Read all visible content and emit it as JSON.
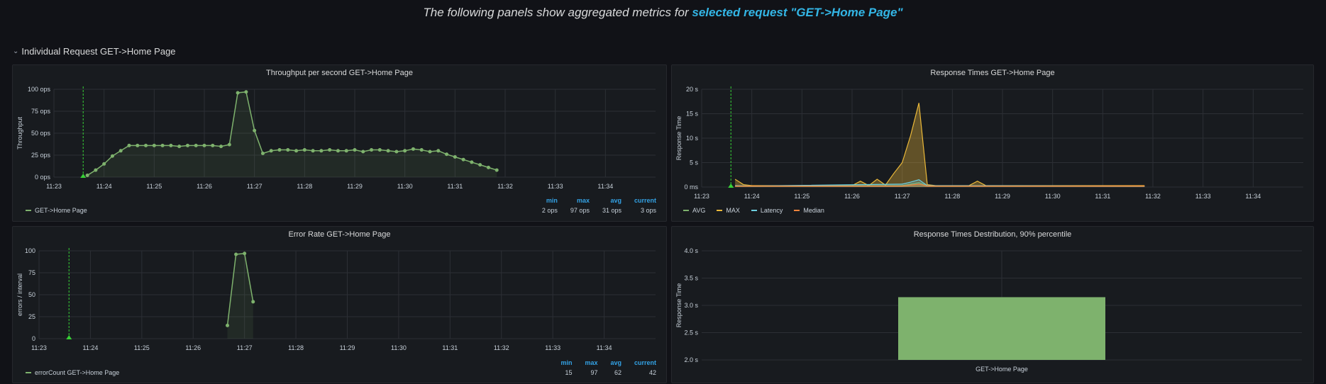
{
  "banner": {
    "prefix": "The following panels show aggregated metrics for",
    "highlight": "selected request \"GET->Home Page\""
  },
  "row": {
    "title": "Individual Request GET->Home Page",
    "icon": "chevron-down-icon"
  },
  "colors": {
    "green": "#7eb26d",
    "yellow": "#eab839",
    "cyan": "#6ed0e0",
    "orange": "#ef843c",
    "bar": "#7eb26d",
    "stat_header": "#33a2e5",
    "link": "#33b5e5"
  },
  "panels": {
    "throughput": {
      "title": "Throughput per second GET->Home Page",
      "ylabel": "Throughput",
      "legend": [
        {
          "name": "GET->Home Page",
          "color": "#7eb26d"
        }
      ],
      "stats": {
        "headers": [
          "min",
          "max",
          "avg",
          "current"
        ],
        "values": [
          "2 ops",
          "97 ops",
          "31 ops",
          "3 ops"
        ]
      }
    },
    "response_times": {
      "title": "Response Times GET->Home Page",
      "ylabel": "Response Time",
      "legend": [
        {
          "name": "AVG",
          "color": "#7eb26d"
        },
        {
          "name": "MAX",
          "color": "#eab839"
        },
        {
          "name": "Latency",
          "color": "#6ed0e0"
        },
        {
          "name": "Median",
          "color": "#ef843c"
        }
      ]
    },
    "error_rate": {
      "title": "Error Rate GET->Home Page",
      "ylabel": "errors / interval",
      "legend": [
        {
          "name": "errorCount GET->Home Page",
          "color": "#7eb26d"
        }
      ],
      "stats": {
        "headers": [
          "min",
          "max",
          "avg",
          "current"
        ],
        "values": [
          "15",
          "97",
          "62",
          "42"
        ]
      }
    },
    "distribution": {
      "title": "Response Times Destribution, 90% percentile",
      "ylabel": "Response Time",
      "category": "GET->Home Page"
    }
  },
  "chart_data": [
    {
      "type": "line",
      "title": "Throughput per second GET->Home Page",
      "ylabel": "Throughput",
      "ylim": [
        0,
        100
      ],
      "yticks": [
        "0 ops",
        "25 ops",
        "50 ops",
        "75 ops",
        "100 ops"
      ],
      "xticks": [
        "11:23",
        "11:24",
        "11:25",
        "11:26",
        "11:27",
        "11:28",
        "11:29",
        "11:30",
        "11:31",
        "11:32",
        "11:33",
        "11:34"
      ],
      "xlim": [
        "11:23",
        "11:35"
      ],
      "marker": "11:23:35",
      "series": [
        {
          "name": "GET->Home Page",
          "x": [
            "11:23:40",
            "11:23:50",
            "11:24:00",
            "11:24:10",
            "11:24:20",
            "11:24:30",
            "11:24:40",
            "11:24:50",
            "11:25:00",
            "11:25:10",
            "11:25:20",
            "11:25:30",
            "11:25:40",
            "11:25:50",
            "11:26:00",
            "11:26:10",
            "11:26:20",
            "11:26:30",
            "11:26:40",
            "11:26:50",
            "11:27:00",
            "11:27:10",
            "11:27:20",
            "11:27:30",
            "11:27:40",
            "11:27:50",
            "11:28:00",
            "11:28:10",
            "11:28:20",
            "11:28:30",
            "11:28:40",
            "11:28:50",
            "11:29:00",
            "11:29:10",
            "11:29:20",
            "11:29:30",
            "11:29:40",
            "11:29:50",
            "11:30:00",
            "11:30:10",
            "11:30:20",
            "11:30:30",
            "11:30:40",
            "11:30:50",
            "11:31:00",
            "11:31:10",
            "11:31:20",
            "11:31:30",
            "11:31:40",
            "11:31:50"
          ],
          "values": [
            2,
            8,
            15,
            24,
            30,
            36,
            36,
            36,
            36,
            36,
            36,
            35,
            36,
            36,
            36,
            36,
            35,
            37,
            96,
            97,
            53,
            27,
            30,
            31,
            31,
            30,
            31,
            30,
            30,
            31,
            30,
            30,
            31,
            29,
            31,
            31,
            30,
            29,
            30,
            32,
            31,
            29,
            30,
            26,
            23,
            20,
            17,
            14,
            11,
            8
          ]
        }
      ]
    },
    {
      "type": "area",
      "title": "Response Times GET->Home Page",
      "ylabel": "Response Time",
      "ylim": [
        0,
        20
      ],
      "yticks": [
        "0 ms",
        "5 s",
        "10 s",
        "15 s",
        "20 s"
      ],
      "xticks": [
        "11:23",
        "11:24",
        "11:25",
        "11:26",
        "11:27",
        "11:28",
        "11:29",
        "11:30",
        "11:31",
        "11:32",
        "11:33",
        "11:34"
      ],
      "xlim": [
        "11:23",
        "11:35"
      ],
      "marker": "11:23:35",
      "series": [
        {
          "name": "MAX",
          "x": [
            "11:23:40",
            "11:23:50",
            "11:24:00",
            "11:25:00",
            "11:26:00",
            "11:26:10",
            "11:26:20",
            "11:26:30",
            "11:26:40",
            "11:26:50",
            "11:27:00",
            "11:27:10",
            "11:27:20",
            "11:27:30",
            "11:27:40",
            "11:28:00",
            "11:28:20",
            "11:28:30",
            "11:28:40",
            "11:29:00",
            "11:30:00",
            "11:31:00",
            "11:31:50"
          ],
          "values": [
            1.6,
            0.5,
            0.3,
            0.3,
            0.3,
            1.2,
            0.3,
            1.6,
            0.4,
            2.8,
            5.0,
            10.5,
            17.2,
            0.5,
            0.3,
            0.3,
            0.3,
            1.2,
            0.3,
            0.3,
            0.3,
            0.3,
            0.3
          ]
        },
        {
          "name": "AVG",
          "x": [
            "11:23:40",
            "11:24:00",
            "11:27:00",
            "11:27:10",
            "11:27:20",
            "11:27:30",
            "11:31:50"
          ],
          "values": [
            0.3,
            0.2,
            0.3,
            0.6,
            0.9,
            0.3,
            0.2
          ]
        },
        {
          "name": "Latency",
          "x": [
            "11:23:40",
            "11:24:00",
            "11:27:00",
            "11:27:10",
            "11:27:20",
            "11:27:30",
            "11:31:50"
          ],
          "values": [
            0.3,
            0.2,
            0.6,
            1.0,
            1.5,
            0.3,
            0.2
          ]
        },
        {
          "name": "Median",
          "x": [
            "11:23:40",
            "11:24:00",
            "11:27:00",
            "11:27:10",
            "11:27:20",
            "11:27:30",
            "11:31:50"
          ],
          "values": [
            0.2,
            0.2,
            0.2,
            0.4,
            0.6,
            0.2,
            0.2
          ]
        }
      ]
    },
    {
      "type": "line",
      "title": "Error Rate GET->Home Page",
      "ylabel": "errors / interval",
      "ylim": [
        0,
        100
      ],
      "yticks": [
        "0",
        "25",
        "50",
        "75",
        "100"
      ],
      "xticks": [
        "11:23",
        "11:24",
        "11:25",
        "11:26",
        "11:27",
        "11:28",
        "11:29",
        "11:30",
        "11:31",
        "11:32",
        "11:33",
        "11:34"
      ],
      "xlim": [
        "11:23",
        "11:35"
      ],
      "marker": "11:23:35",
      "series": [
        {
          "name": "errorCount GET->Home Page",
          "x": [
            "11:26:40",
            "11:26:50",
            "11:27:00",
            "11:27:10"
          ],
          "values": [
            15,
            96,
            97,
            42
          ]
        }
      ]
    },
    {
      "type": "bar",
      "title": "Response Times Destribution, 90% percentile",
      "ylabel": "Response Time",
      "categories": [
        "GET->Home Page"
      ],
      "values": [
        3.15
      ],
      "ylim": [
        2.0,
        4.0
      ],
      "yticks": [
        "2.0 s",
        "2.5 s",
        "3.0 s",
        "3.5 s",
        "4.0 s"
      ]
    }
  ]
}
